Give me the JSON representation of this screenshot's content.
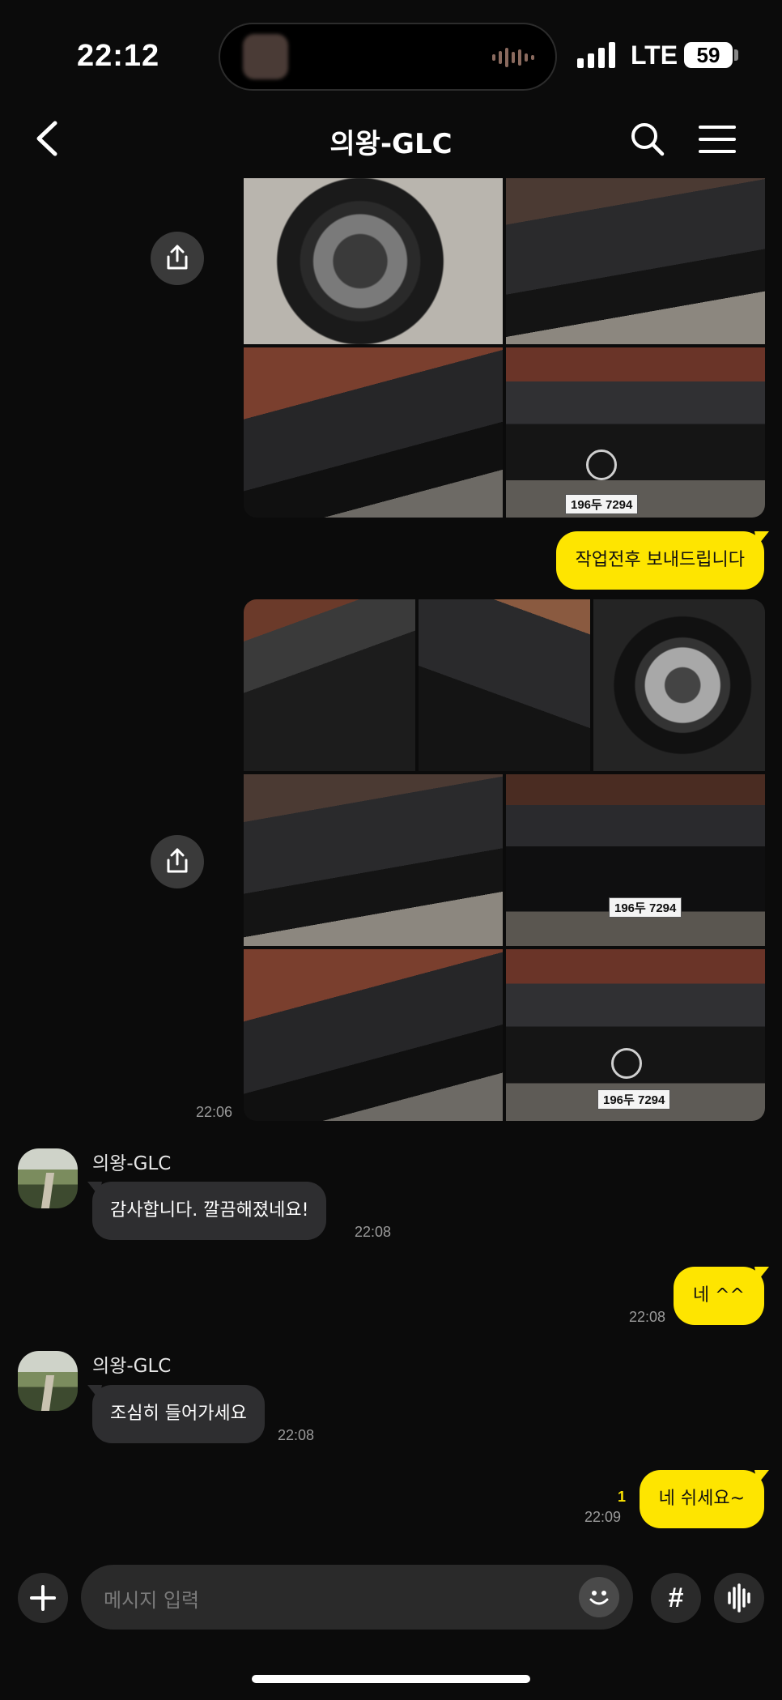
{
  "status_bar": {
    "time": "22:12",
    "network": "LTE",
    "battery": "59"
  },
  "header": {
    "title": "의왕-GLC"
  },
  "grid_a": {
    "photos": [
      "wheel-closeup-photo",
      "car-side-photo",
      "car-three-quarter-photo",
      "car-front-photo"
    ],
    "plate": "196두 7294"
  },
  "grid_b": {
    "photos": [
      "rear-seat-photo",
      "driver-seat-photo",
      "wheel-closeup-photo",
      "car-rear-side-photo",
      "car-rear-photo",
      "car-side-photo",
      "car-front-photo"
    ],
    "plate": "196두 7294",
    "time": "22:06"
  },
  "messages": [
    {
      "from": "me",
      "text": "작업전후 보내드립니다"
    },
    {
      "from": "other",
      "sender": "의왕-GLC",
      "text": "감사합니다. 깔끔해졌네요!",
      "time": "22:08"
    },
    {
      "from": "me",
      "text": "네 ^^",
      "time": "22:08"
    },
    {
      "from": "other",
      "sender": "의왕-GLC",
      "text": "조심히 들어가세요",
      "time": "22:08"
    },
    {
      "from": "me",
      "text": "네 쉬세요~",
      "time": "22:09",
      "unread": "1"
    }
  ],
  "input": {
    "placeholder": "메시지 입력",
    "hash_label": "#"
  },
  "colors": {
    "my_bubble": "#fee500",
    "other_bubble": "#2e2e30",
    "background": "#0b0b0b"
  }
}
